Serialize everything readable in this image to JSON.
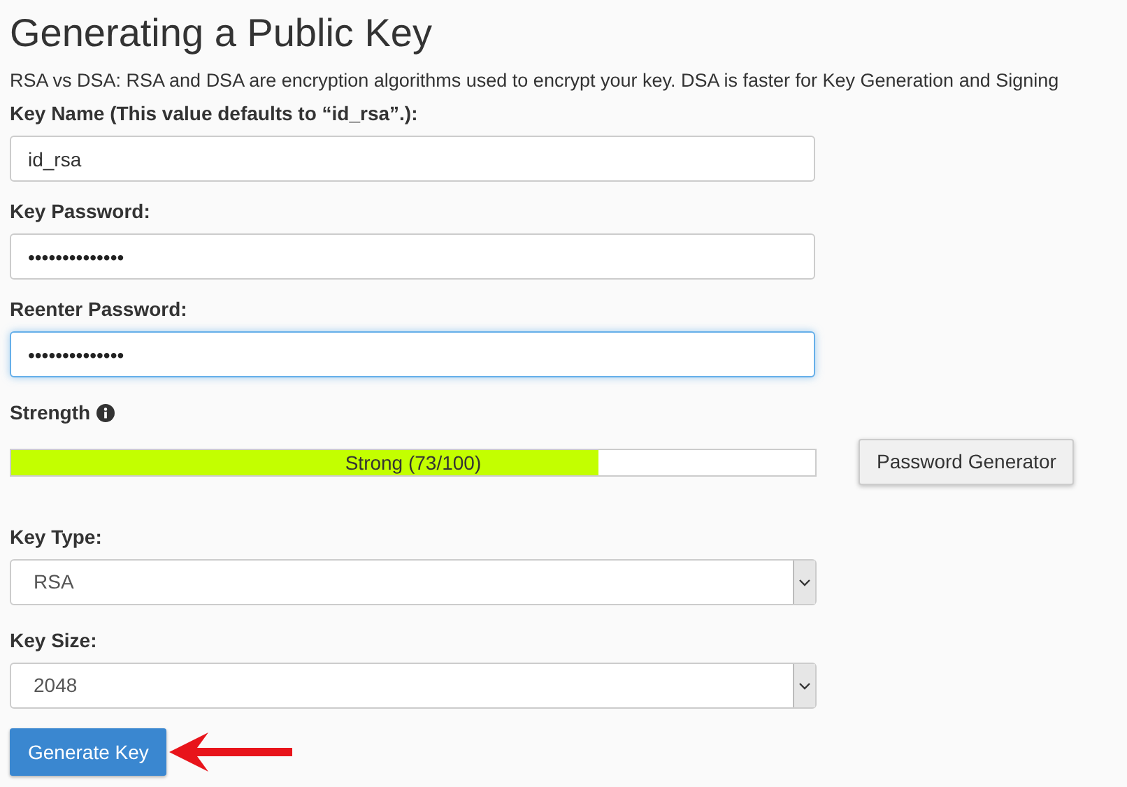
{
  "title": "Generating a Public Key",
  "description": "RSA vs DSA: RSA and DSA are encryption algorithms used to encrypt your key. DSA is faster for Key Generation and Signing",
  "fields": [
    {
      "kind": "text",
      "label": "Key Name (This value defaults to “id_rsa”.):",
      "value": "id_rsa",
      "focused": false
    },
    {
      "kind": "password",
      "label": "Key Password:",
      "value": "••••••••••••••",
      "focused": false
    },
    {
      "kind": "password",
      "label": "Reenter Password:",
      "value": "••••••••••••••",
      "focused": true
    }
  ],
  "strength": {
    "label": "Strength",
    "level": 0.73,
    "reading": "Strong (73/100)"
  },
  "password_generator_button": "Password Generator",
  "selects": [
    {
      "label": "Key Type:",
      "value": "RSA"
    },
    {
      "label": "Key Size:",
      "value": "2048"
    }
  ],
  "generate_button": "Generate Key"
}
